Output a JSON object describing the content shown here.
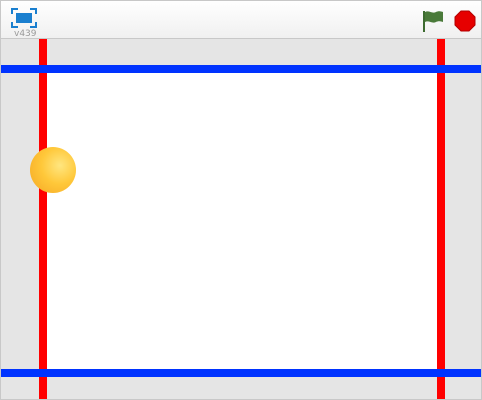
{
  "toolbar": {
    "version": "v439",
    "fullscreen_icon": "fullscreen-icon",
    "green_flag_icon": "green-flag-icon",
    "stop_icon": "stop-icon"
  },
  "colors": {
    "vertical_lines": "#ff0000",
    "horizontal_lines": "#0033ff",
    "margin_fill": "#e5e5e5",
    "stage_fill": "#ffffff",
    "ball": "#ffc83a",
    "flag": "#4a7a3a",
    "stop": "#e60000",
    "fullscreen": "#1a7fcf"
  },
  "stage": {
    "sprites": [
      {
        "name": "ball",
        "shape": "circle"
      }
    ],
    "lines": [
      {
        "name": "left-red-line",
        "orientation": "vertical",
        "color": "red"
      },
      {
        "name": "right-red-line",
        "orientation": "vertical",
        "color": "red"
      },
      {
        "name": "top-blue-line",
        "orientation": "horizontal",
        "color": "blue"
      },
      {
        "name": "bottom-blue-line",
        "orientation": "horizontal",
        "color": "blue"
      }
    ]
  }
}
